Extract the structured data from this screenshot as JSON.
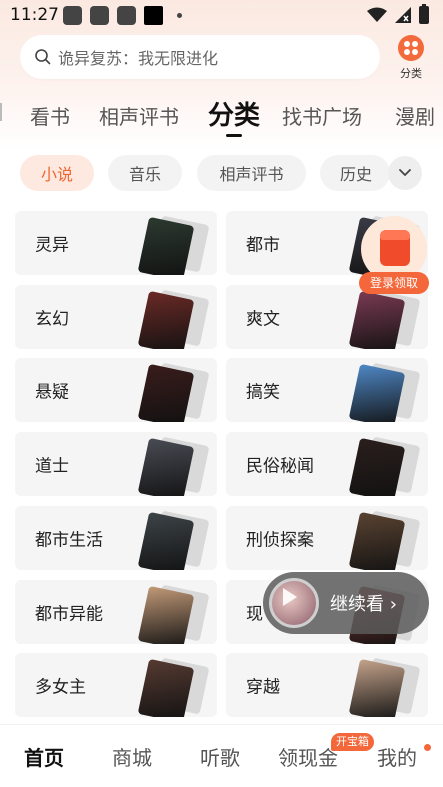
{
  "status_bar": {
    "time": "11:27"
  },
  "search": {
    "placeholder": "诡异复苏：我无限进化"
  },
  "category_button": {
    "label": "分类"
  },
  "top_tabs": [
    {
      "label": "看书"
    },
    {
      "label": "相声评书"
    },
    {
      "label": "分类",
      "active": true
    },
    {
      "label": "找书广场"
    },
    {
      "label": "漫剧"
    }
  ],
  "chips": [
    {
      "label": "小说",
      "active": true
    },
    {
      "label": "音乐"
    },
    {
      "label": "相声评书"
    },
    {
      "label": "历史"
    }
  ],
  "categories": [
    {
      "label": "灵异",
      "cover_color": "#2c3a30"
    },
    {
      "label": "都市",
      "cover_color": "#3b3b46"
    },
    {
      "label": "玄幻",
      "cover_color": "#6b2a26"
    },
    {
      "label": "爽文",
      "cover_color": "#7a3a52"
    },
    {
      "label": "悬疑",
      "cover_color": "#3a1c1c"
    },
    {
      "label": "搞笑",
      "cover_color": "#4f88c6"
    },
    {
      "label": "道士",
      "cover_color": "#4a4c55"
    },
    {
      "label": "民俗秘闻",
      "cover_color": "#2a1f1c"
    },
    {
      "label": "都市生活",
      "cover_color": "#3d4448"
    },
    {
      "label": "刑侦探案",
      "cover_color": "#5a4332"
    },
    {
      "label": "都市异能",
      "cover_color": "#c29a78"
    },
    {
      "label": "现",
      "cover_color": "#8b3d3a"
    },
    {
      "label": "多女主",
      "cover_color": "#563b32"
    },
    {
      "label": "穿越",
      "cover_color": "#c4a38b"
    }
  ],
  "red_packet": {
    "label": "登录领取",
    "color": "#f04b2a"
  },
  "continue_reading": {
    "label": "继续看 ›"
  },
  "bottom_nav": [
    {
      "label": "首页",
      "active": true
    },
    {
      "label": "商城"
    },
    {
      "label": "听歌"
    },
    {
      "label": "领现金",
      "badge": "开宝箱"
    },
    {
      "label": "我的"
    }
  ],
  "colors": {
    "accent": "#f3673a",
    "chip_active_bg": "#fde9df",
    "card_bg": "#f5f5f5"
  }
}
